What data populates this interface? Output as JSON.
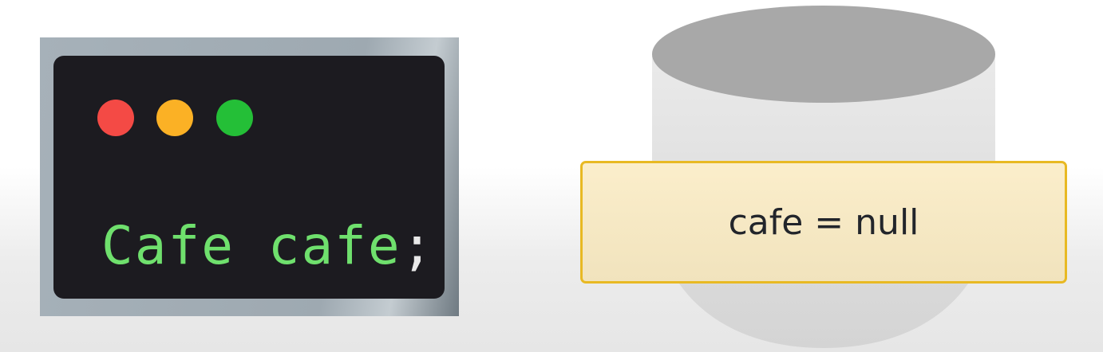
{
  "terminal": {
    "code_type": "Cafe",
    "code_var": "cafe",
    "code_end": ";",
    "window_buttons": [
      {
        "name": "close",
        "color": "#f44a45"
      },
      {
        "name": "minimize",
        "color": "#fbb125"
      },
      {
        "name": "maximize",
        "color": "#24bf37"
      }
    ]
  },
  "object": {
    "label": "cafe = null",
    "border_color": "#e8b923"
  }
}
